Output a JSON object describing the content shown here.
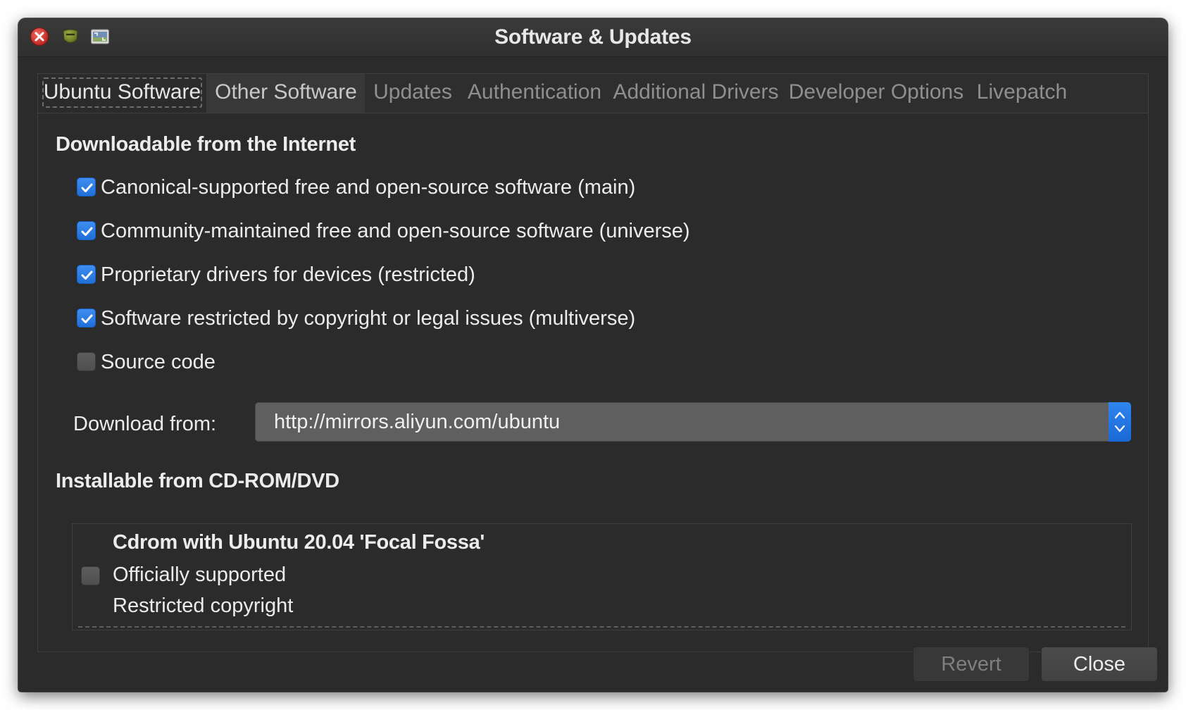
{
  "window": {
    "title": "Software & Updates"
  },
  "tabs": [
    {
      "label": "Ubuntu Software",
      "state": "active"
    },
    {
      "label": "Other Software",
      "state": "normal"
    },
    {
      "label": "Updates",
      "state": "normal"
    },
    {
      "label": "Authentication",
      "state": "normal"
    },
    {
      "label": "Additional Drivers",
      "state": "normal"
    },
    {
      "label": "Developer Options",
      "state": "normal"
    },
    {
      "label": "Livepatch",
      "state": "normal"
    }
  ],
  "internet": {
    "heading": "Downloadable from the Internet",
    "options": [
      {
        "label": "Canonical-supported free and open-source software (main)",
        "checked": true
      },
      {
        "label": "Community-maintained free and open-source software (universe)",
        "checked": true
      },
      {
        "label": "Proprietary drivers for devices (restricted)",
        "checked": true
      },
      {
        "label": "Software restricted by copyright or legal issues (multiverse)",
        "checked": true
      },
      {
        "label": "Source code",
        "checked": false
      }
    ],
    "download_from_label": "Download from:",
    "download_from_value": "http://mirrors.aliyun.com/ubuntu"
  },
  "cdrom": {
    "heading": "Installable from CD-ROM/DVD",
    "entry_title": "Cdrom with Ubuntu 20.04 'Focal Fossa'",
    "entry_line1": "Officially supported",
    "entry_line2": "Restricted copyright",
    "checked": false
  },
  "buttons": {
    "revert": "Revert",
    "close": "Close"
  },
  "colors": {
    "accent": "#2479e6",
    "window_bg": "#2b2b2b",
    "close_button": "#d9332a"
  },
  "icons": {
    "close": "close-icon",
    "minimize": "minimize-icon",
    "maximize": "maximize-icon",
    "checkmark": "checkmark-icon",
    "combo_arrows": "up-down-chevron-icon"
  }
}
